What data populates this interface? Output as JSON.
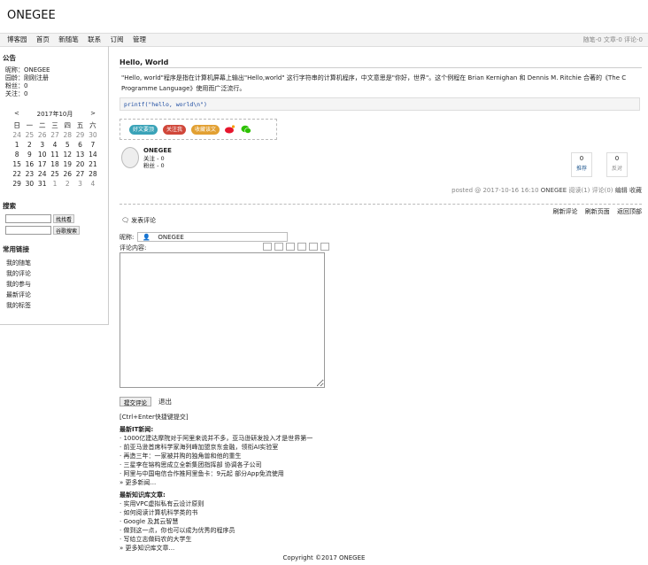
{
  "site": {
    "title": "ONEGEE"
  },
  "nav": {
    "items": [
      "博客园",
      "首页",
      "新随笔",
      "联系",
      "订阅",
      "管理"
    ],
    "stats": "随笔-0  文章-0  评论-0"
  },
  "sidebar": {
    "notice_h": "公告",
    "profile": [
      "昵称：ONEGEE",
      "园龄：刚刚注册",
      "粉丝：0",
      "关注：0"
    ],
    "calendar": {
      "prev": "<",
      "title": "2017年10月",
      "next": ">",
      "week": [
        "日",
        "一",
        "二",
        "三",
        "四",
        "五",
        "六"
      ],
      "rows": [
        [
          "24",
          "25",
          "26",
          "27",
          "28",
          "29",
          "30"
        ],
        [
          "1",
          "2",
          "3",
          "4",
          "5",
          "6",
          "7"
        ],
        [
          "8",
          "9",
          "10",
          "11",
          "12",
          "13",
          "14"
        ],
        [
          "15",
          "16",
          "17",
          "18",
          "19",
          "20",
          "21"
        ],
        [
          "22",
          "23",
          "24",
          "25",
          "26",
          "27",
          "28"
        ],
        [
          "29",
          "30",
          "31",
          "1",
          "2",
          "3",
          "4"
        ]
      ]
    },
    "search_h": "搜索",
    "search_btn1": "找找看",
    "search_btn2": "谷歌搜索",
    "links_h": "常用链接",
    "links": [
      "我的随笔",
      "我的评论",
      "我的参与",
      "最新评论",
      "我的标签"
    ]
  },
  "post": {
    "title": "Hello, World",
    "body": "\"Hello, world\"程序是指在计算机屏幕上输出\"Hello,world\" 这行字符串的计算机程序，中文意思是\"你好，世界\"。这个例程在 Brian Kernighan 和 Dennis M. Ritchie 合著的《The C Programme Language》使用而广泛流行。",
    "code": "printf(\"hello, world\\n\")",
    "share": [
      "好文要顶",
      "关注我",
      "收藏该文"
    ],
    "author": {
      "name": "ONEGEE",
      "follow": "关注 - 0",
      "fans": "粉丝 - 0"
    },
    "votes": [
      {
        "n": "0",
        "l": "推荐"
      },
      {
        "n": "0",
        "l": "反对"
      }
    ],
    "posted_prefix": "posted @ 2017-10-16 16:10",
    "posted_author": "ONEGEE",
    "posted_suffix": "阅读(1) 评论(0)",
    "edit": "编辑",
    "fav": "收藏"
  },
  "comments": {
    "links": [
      "刷新评论",
      "刷新页面",
      "返回顶部"
    ],
    "header": "发表评论",
    "nick_label": "昵称:",
    "nick_value": "ONEGEE",
    "content_label": "评论内容:",
    "submit": "提交评论",
    "logout": "退出",
    "tip": "[Ctrl+Enter快捷键提交]"
  },
  "news": {
    "it_h": "最新IT新闻:",
    "it": [
      "· 1000亿建达摩院对于阿里来说并不多，亚马逊研发投入才是世界第一",
      "· 前亚马逊首席科学家海列峰加盟京东金融，领衔AI实验室",
      "· 再造三年：一家被并购的独角兽和他的重生",
      "· 三星李在镕构思成立全新集团指挥部 协调各子公司",
      "· 阿里与中国电信合作推阿里鱼卡：9元起 部分App免流使用"
    ],
    "it_more": "» 更多新闻...",
    "kb_h": "最新知识库文章:",
    "kb": [
      "· 实用VPC虚拟私有云设计原则",
      "· 如何阅读计算机科学类的书",
      "· Google 及其云智慧",
      "· 做到这一点，你也可以成为优秀的程序员",
      "· 写给立志做码农的大学生"
    ],
    "kb_more": "» 更多知识库文章..."
  },
  "footer": "Copyright ©2017 ONEGEE",
  "colors": {
    "share1": "#3aa3b8",
    "share2": "#d0473a",
    "share3": "#e2a032"
  }
}
